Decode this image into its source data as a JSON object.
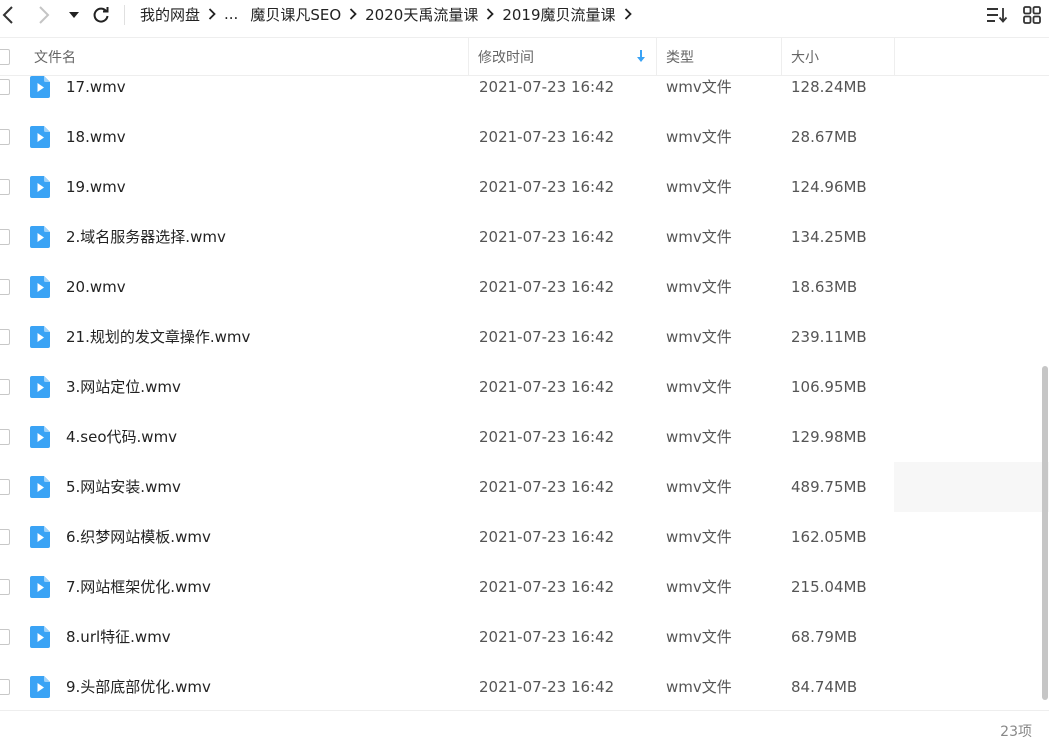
{
  "nav": {
    "back_icon": "chevron-left-icon",
    "forward_icon": "chevron-right-icon",
    "dropdown_icon": "caret-down-icon",
    "refresh_icon": "refresh-icon"
  },
  "breadcrumb": {
    "items": [
      "我的网盘",
      "...",
      "魔贝课凡SEO",
      "2020天禹流量课",
      "2019魔贝流量课"
    ]
  },
  "toolbar": {
    "sort_icon": "sort-list-icon",
    "grid_icon": "grid-view-icon"
  },
  "columns": {
    "name": "文件名",
    "modified": "修改时间",
    "type": "类型",
    "size": "大小",
    "sort_icon": "sort-down-arrow-icon"
  },
  "files": [
    {
      "name": "17.wmv",
      "modified": "2021-07-23 16:42",
      "type": "wmv文件",
      "size": "128.24MB"
    },
    {
      "name": "18.wmv",
      "modified": "2021-07-23 16:42",
      "type": "wmv文件",
      "size": "28.67MB"
    },
    {
      "name": "19.wmv",
      "modified": "2021-07-23 16:42",
      "type": "wmv文件",
      "size": "124.96MB"
    },
    {
      "name": "2.域名服务器选择.wmv",
      "modified": "2021-07-23 16:42",
      "type": "wmv文件",
      "size": "134.25MB"
    },
    {
      "name": "20.wmv",
      "modified": "2021-07-23 16:42",
      "type": "wmv文件",
      "size": "18.63MB"
    },
    {
      "name": "21.规划的发文章操作.wmv",
      "modified": "2021-07-23 16:42",
      "type": "wmv文件",
      "size": "239.11MB"
    },
    {
      "name": "3.网站定位.wmv",
      "modified": "2021-07-23 16:42",
      "type": "wmv文件",
      "size": "106.95MB"
    },
    {
      "name": "4.seo代码.wmv",
      "modified": "2021-07-23 16:42",
      "type": "wmv文件",
      "size": "129.98MB"
    },
    {
      "name": "5.网站安装.wmv",
      "modified": "2021-07-23 16:42",
      "type": "wmv文件",
      "size": "489.75MB"
    },
    {
      "name": "6.织梦网站模板.wmv",
      "modified": "2021-07-23 16:42",
      "type": "wmv文件",
      "size": "162.05MB"
    },
    {
      "name": "7.网站框架优化.wmv",
      "modified": "2021-07-23 16:42",
      "type": "wmv文件",
      "size": "215.04MB"
    },
    {
      "name": "8.url特征.wmv",
      "modified": "2021-07-23 16:42",
      "type": "wmv文件",
      "size": "68.79MB"
    },
    {
      "name": "9.头部底部优化.wmv",
      "modified": "2021-07-23 16:42",
      "type": "wmv文件",
      "size": "84.74MB"
    }
  ],
  "file_icon": "video-file-icon",
  "footer": {
    "count": "23项"
  },
  "colors": {
    "accent": "#3aa3f5",
    "text": "#222222",
    "muted": "#555555"
  }
}
